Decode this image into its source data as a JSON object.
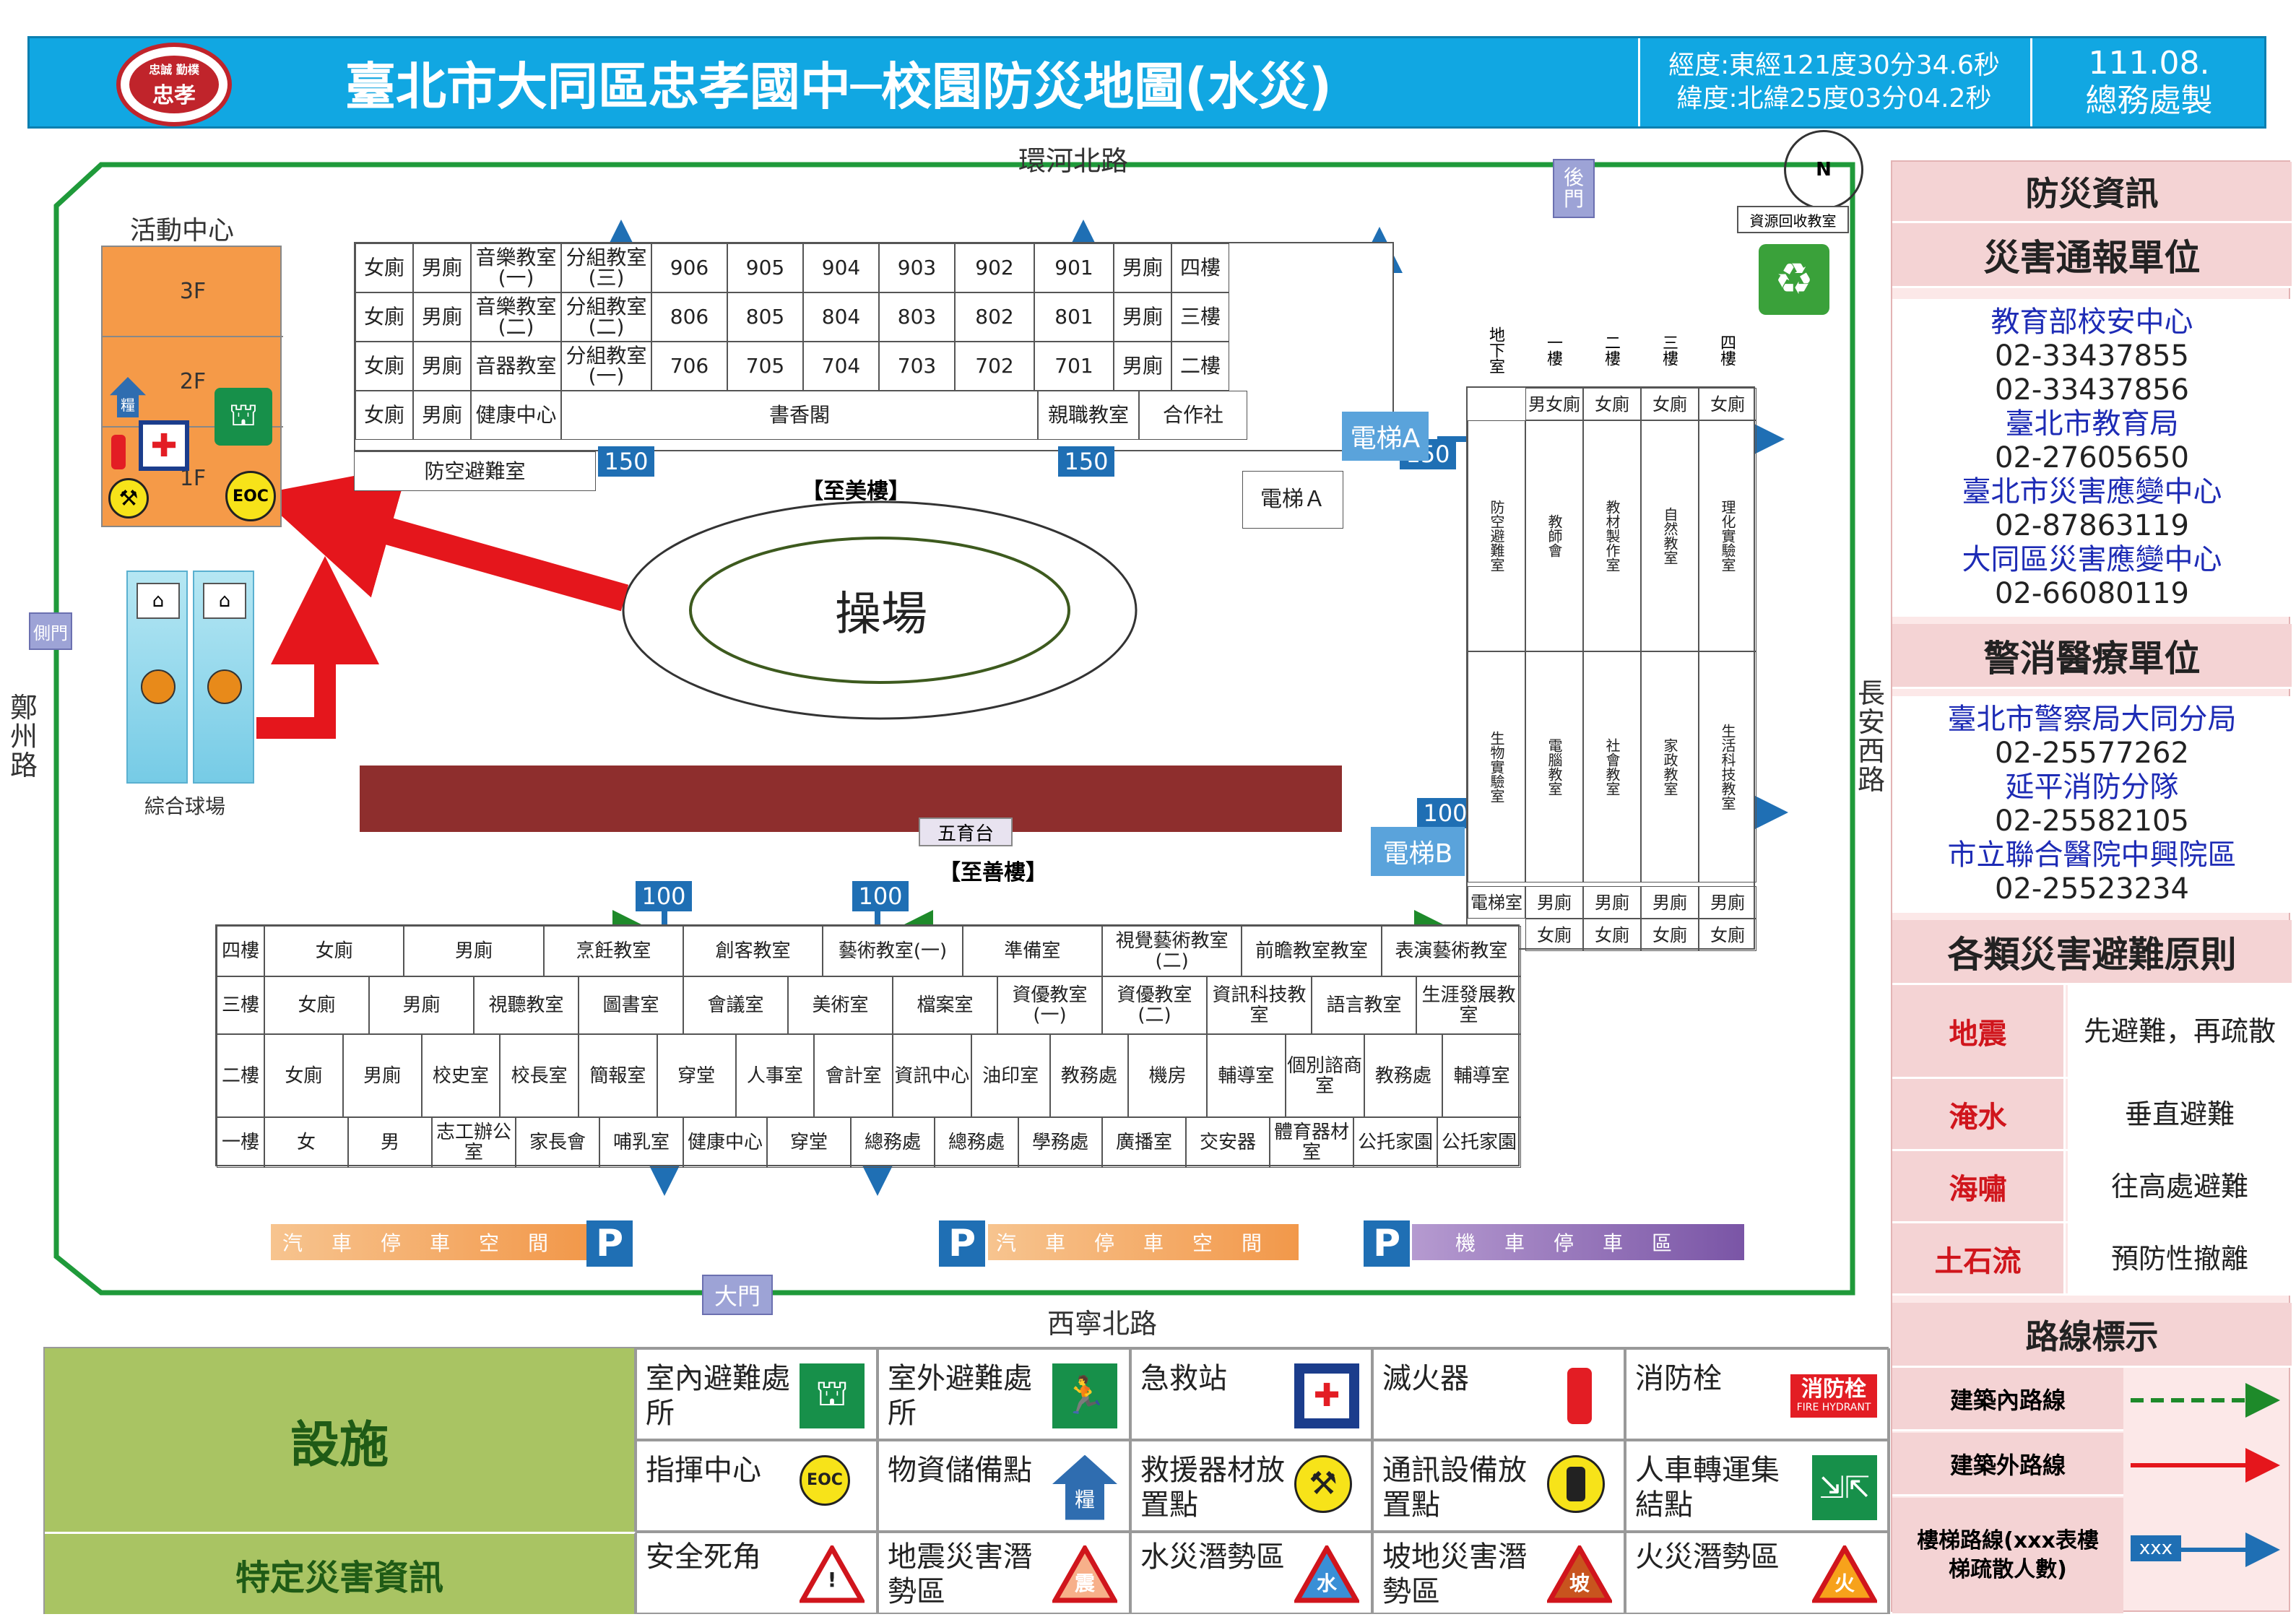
{
  "header": {
    "logo_top": "忠誠 勤樸",
    "logo_text": "忠孝",
    "title": "臺北市大同區忠孝國中─校園防災地圖(水災)",
    "longitude": "經度:東經121度30分34.6秒",
    "latitude": "緯度:北緯25度03分04.2秒",
    "date": "111.08.",
    "maker": "總務處製"
  },
  "map": {
    "roads": {
      "north": "環河北路",
      "south": "西寧北路",
      "west": "鄭州路",
      "east": "長安西路"
    },
    "gates": {
      "back": "後門",
      "side": "側門",
      "main": "大門"
    },
    "compass": "N",
    "recycle": "資源回收教室",
    "activity_center": {
      "title": "活動中心",
      "floors": [
        "3F",
        "2F",
        "1F"
      ]
    },
    "court": "綜合球場",
    "playground": "操場",
    "stage": "五育台",
    "to_mei": "【至美樓】",
    "to_shan": "【至善樓】",
    "elevator_a": "電梯Ａ",
    "elevator_a2": "電梯A",
    "elevator_b": "電梯B",
    "stair_counts": [
      "150",
      "150",
      "150",
      "100",
      "100",
      "100"
    ],
    "north_building": {
      "rows": [
        [
          "女廁",
          "男廁",
          "音樂教室(一)",
          "分組教室(三)",
          "906",
          "905",
          "904",
          "903",
          "902",
          "901",
          "男廁",
          "四樓"
        ],
        [
          "女廁",
          "男廁",
          "音樂教室(二)",
          "分組教室(二)",
          "806",
          "805",
          "804",
          "803",
          "802",
          "801",
          "男廁",
          "三樓"
        ],
        [
          "女廁",
          "男廁",
          "音器教室",
          "分組教室(一)",
          "706",
          "705",
          "704",
          "703",
          "702",
          "701",
          "男廁",
          "二樓"
        ],
        [
          "女廁",
          "男廁",
          "健康中心",
          "書香閣",
          "親職教室",
          "合作社"
        ]
      ],
      "shelter": "防空避難室"
    },
    "east_building": {
      "header": [
        "地下室",
        "一樓",
        "二樓",
        "三樓",
        "四樓"
      ],
      "toilets_top": [
        "男女廁",
        "女廁",
        "女廁",
        "女廁"
      ],
      "rooms": [
        "防空避難室",
        "教師會",
        "教材製作室",
        "自然教室",
        "理化實驗室",
        "生物實驗室",
        "電腦教室",
        "社會教室",
        "家政教室",
        "生活科技教室"
      ],
      "bottom": [
        "電梯室",
        "男廁",
        "男廁",
        "男廁",
        "男廁"
      ],
      "bottom2": [
        "女廁",
        "女廁",
        "女廁",
        "女廁"
      ]
    },
    "south_building": {
      "floors": [
        "四樓",
        "三樓",
        "二樓",
        "一樓"
      ],
      "row4": [
        "女廁",
        "男廁",
        "烹飪教室",
        "創客教室",
        "藝術教室(一)",
        "準備室",
        "視覺藝術教室(二)",
        "前瞻教室教室",
        "表演藝術教室"
      ],
      "row3": [
        "女廁",
        "男廁",
        "視聽教室",
        "圖書室",
        "會議室",
        "美術室",
        "檔案室",
        "資優教室(一)",
        "資優教室(二)",
        "資訊科技教室",
        "語言教室",
        "生涯發展教室"
      ],
      "row2": [
        "女廁",
        "男廁",
        "校史室",
        "校長室",
        "簡報室",
        "穿堂",
        "人事室",
        "會計室",
        "資訊中心",
        "油印室",
        "教務處",
        "機房",
        "輔導室",
        "個別諮商室",
        "教務處",
        "輔導室"
      ],
      "row1": [
        "女",
        "男",
        "志工辦公室",
        "家長會",
        "哺乳室",
        "健康中心",
        "穿堂",
        "總務處",
        "總務處",
        "學務處",
        "廣播室",
        "交安器",
        "體育器材室",
        "公托家園",
        "公托家園"
      ]
    },
    "parking": [
      "汽車停車空間",
      "汽車停車空間",
      "機車停車區"
    ],
    "parking_sign": "P"
  },
  "info_panel": {
    "title": "防災資訊",
    "report_title": "災害通報單位",
    "report_units": [
      {
        "name": "教育部校安中心",
        "phones": [
          "02-33437855",
          "02-33437856"
        ]
      },
      {
        "name": "臺北市教育局",
        "phones": [
          "02-27605650"
        ]
      },
      {
        "name": "臺北市災害應變中心",
        "phones": [
          "02-87863119"
        ]
      },
      {
        "name": "大同區災害應變中心",
        "phones": [
          "02-66080119"
        ]
      }
    ],
    "police_title": "警消醫療單位",
    "police_units": [
      {
        "name": "臺北市警察局大同分局",
        "phones": [
          "02-25577262"
        ]
      },
      {
        "name": "延平消防分隊",
        "phones": [
          "02-25582105"
        ]
      },
      {
        "name": "市立聯合醫院中興院區",
        "phones": [
          "02-25523234"
        ]
      }
    ],
    "principles_title": "各類災害避難原則",
    "principles": [
      {
        "disaster": "地震",
        "action": "先避難，再疏散"
      },
      {
        "disaster": "淹水",
        "action": "垂直避難"
      },
      {
        "disaster": "海嘯",
        "action": "往高處避難"
      },
      {
        "disaster": "土石流",
        "action": "預防性撤離"
      }
    ],
    "route_title": "路線標示",
    "routes": [
      {
        "label": "建築內路線",
        "color": "#1e8a2a"
      },
      {
        "label": "建築外路線",
        "color": "#e5161c"
      },
      {
        "label": "樓梯路線(xxx表樓梯疏散人數)",
        "color": "#1f6fb4",
        "sample": "xxx"
      }
    ]
  },
  "legend": {
    "facilities_title": "設施",
    "hazard_title": "特定災害資訊",
    "items_row1": [
      {
        "label": "室內避難處所",
        "icon": "indoor-shelter-icon"
      },
      {
        "label": "室外避難處所",
        "icon": "outdoor-shelter-icon"
      },
      {
        "label": "急救站",
        "icon": "first-aid-icon"
      },
      {
        "label": "滅火器",
        "icon": "extinguisher-icon"
      },
      {
        "label": "消防栓",
        "icon": "fire-hydrant-icon",
        "badge_main": "消防栓",
        "badge_sub": "FIRE HYDRANT"
      }
    ],
    "items_row2": [
      {
        "label": "指揮中心",
        "icon": "eoc-icon",
        "badge": "EOC"
      },
      {
        "label": "物資儲備點",
        "icon": "supply-icon",
        "badge": "糧"
      },
      {
        "label": "救援器材放置點",
        "icon": "rescue-tools-icon"
      },
      {
        "label": "通訊設備放置點",
        "icon": "radio-icon"
      },
      {
        "label": "人車轉運集結點",
        "icon": "assembly-icon"
      }
    ],
    "items_row3": [
      {
        "label": "安全死角",
        "icon": "warning-icon",
        "badge": "!"
      },
      {
        "label": "地震災害潛勢區",
        "icon": "earthquake-zone-icon",
        "badge": "震"
      },
      {
        "label": "水災潛勢區",
        "icon": "flood-zone-icon",
        "badge": "水"
      },
      {
        "label": "坡地災害潛勢區",
        "icon": "slope-zone-icon",
        "badge": "坡"
      },
      {
        "label": "火災潛勢區",
        "icon": "fire-zone-icon",
        "badge": "火"
      }
    ]
  },
  "colors": {
    "header": "#11a7e2",
    "route_inside": "#1e8a2a",
    "route_outside": "#e5161c",
    "route_stairs": "#1f6fb4",
    "panel_header": "#f4d3d4",
    "legend_green": "#a9c463"
  }
}
